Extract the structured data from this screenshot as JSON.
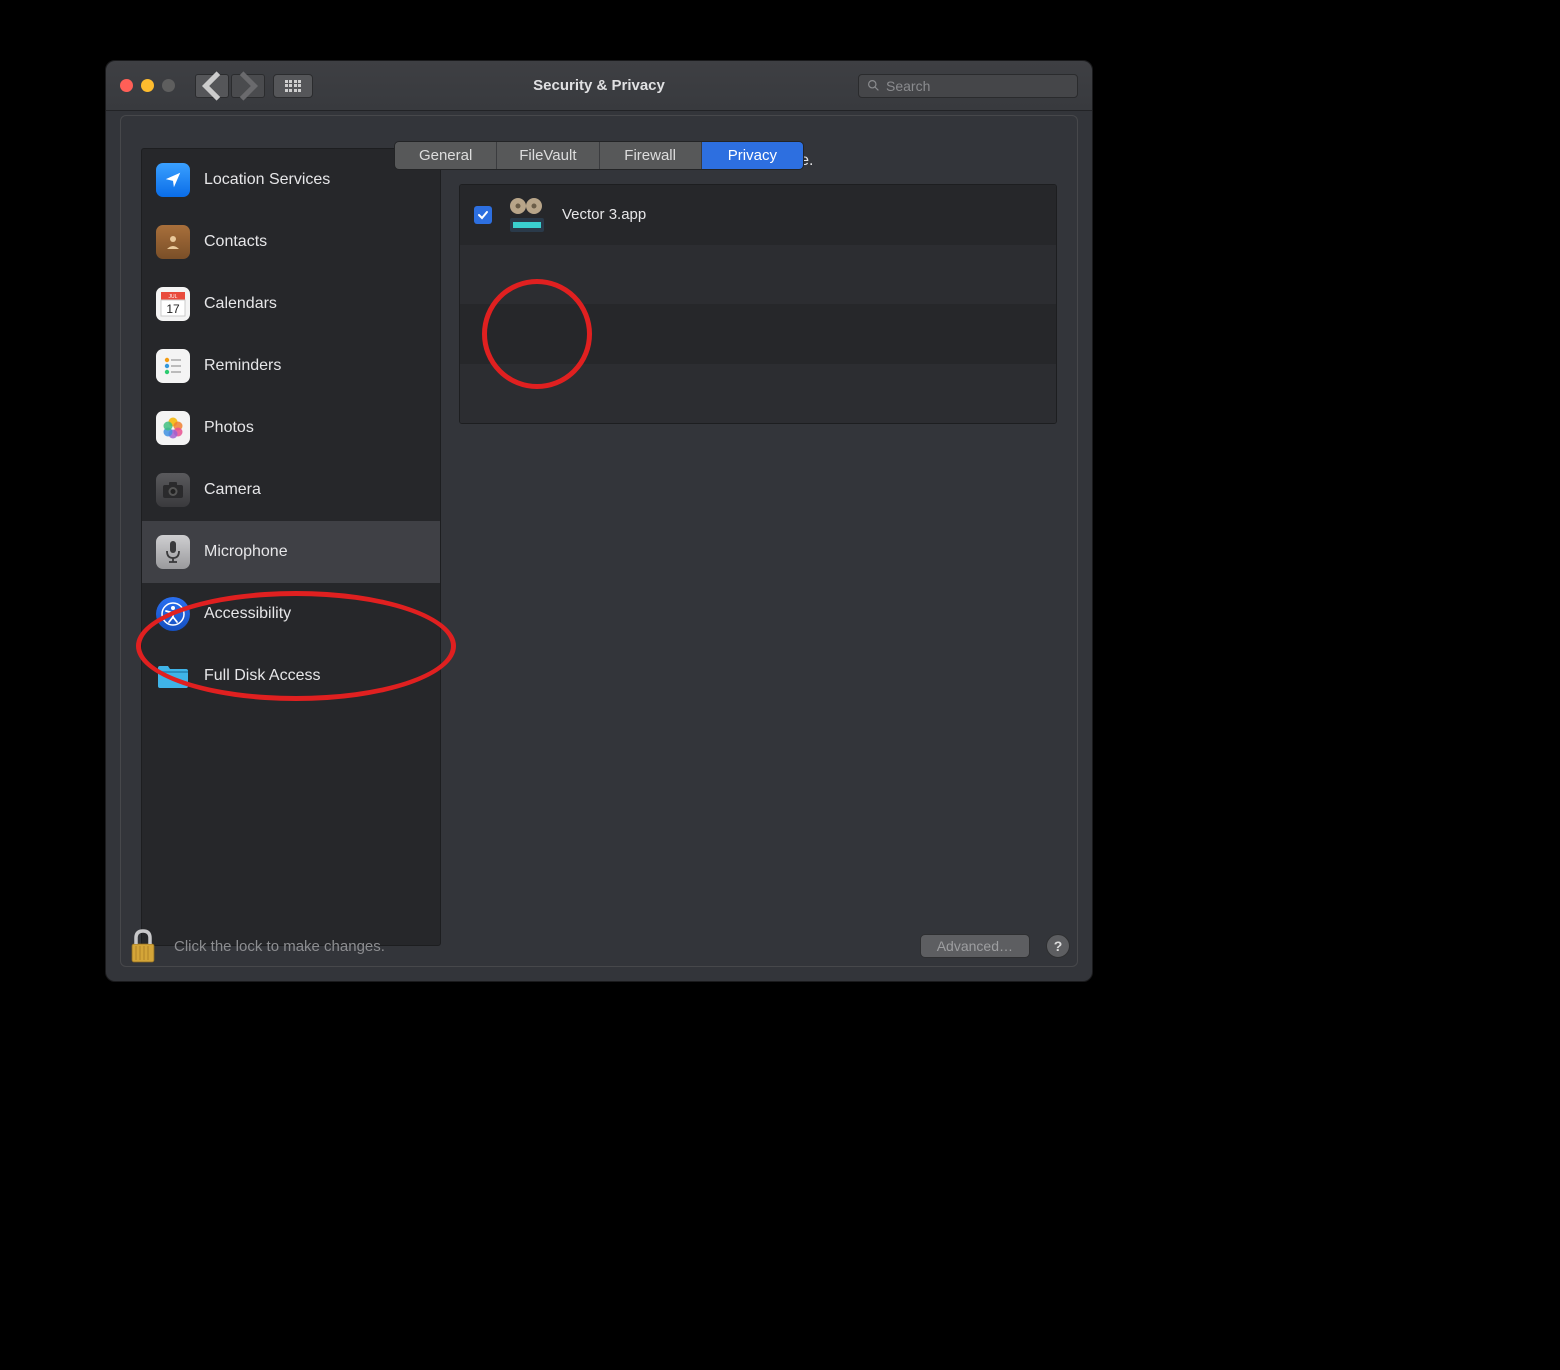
{
  "window": {
    "title": "Security & Privacy",
    "search_placeholder": "Search"
  },
  "tabs": [
    {
      "id": "general",
      "label": "General",
      "active": false
    },
    {
      "id": "filevault",
      "label": "FileVault",
      "active": false
    },
    {
      "id": "firewall",
      "label": "Firewall",
      "active": false
    },
    {
      "id": "privacy",
      "label": "Privacy",
      "active": true
    }
  ],
  "sidebar": {
    "items": [
      {
        "id": "location",
        "label": "Location Services",
        "selected": false
      },
      {
        "id": "contacts",
        "label": "Contacts",
        "selected": false
      },
      {
        "id": "calendars",
        "label": "Calendars",
        "selected": false
      },
      {
        "id": "reminders",
        "label": "Reminders",
        "selected": false
      },
      {
        "id": "photos",
        "label": "Photos",
        "selected": false
      },
      {
        "id": "camera",
        "label": "Camera",
        "selected": false
      },
      {
        "id": "microphone",
        "label": "Microphone",
        "selected": true
      },
      {
        "id": "accessibility",
        "label": "Accessibility",
        "selected": false
      },
      {
        "id": "fulldisk",
        "label": "Full Disk Access",
        "selected": false
      }
    ]
  },
  "content": {
    "header": "Allow the apps below to access your microphone.",
    "apps": [
      {
        "name": "Vector 3.app",
        "checked": true
      }
    ]
  },
  "footer": {
    "lock_text": "Click the lock to make changes.",
    "advanced_label": "Advanced…",
    "help_label": "?"
  },
  "annotations": {
    "circle_sidebar": {
      "target": "microphone"
    },
    "circle_app": {
      "target": "Vector 3.app"
    }
  }
}
